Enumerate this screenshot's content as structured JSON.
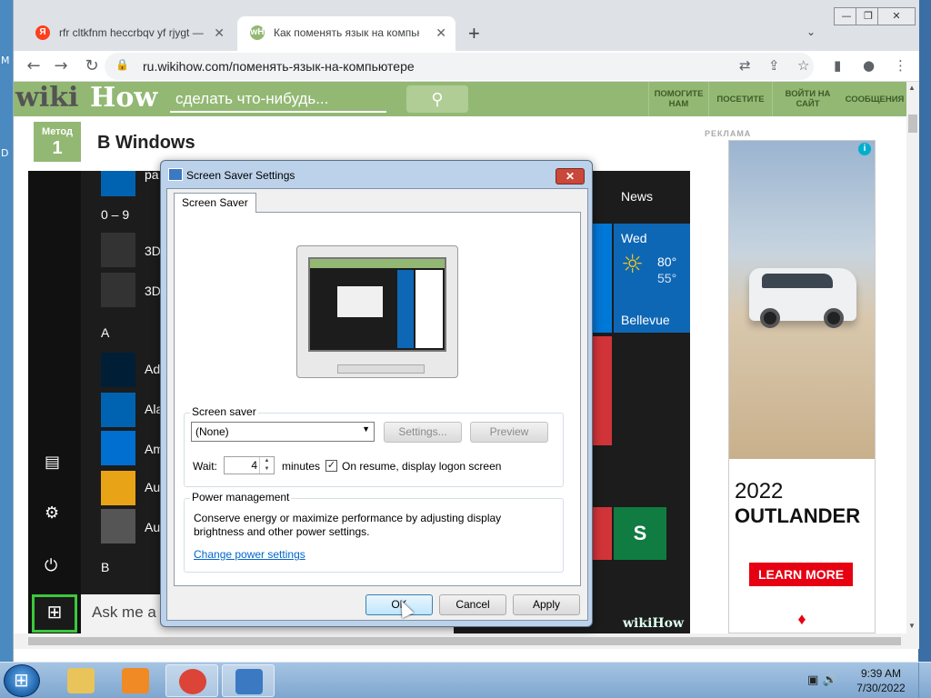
{
  "desktop": {
    "edge_letters": [
      "M",
      "D"
    ]
  },
  "browser": {
    "window_controls": [
      "—",
      "❐",
      "✕"
    ],
    "tabs": [
      {
        "title": "rfr cltkfnm heccrbqv yf rjygt — Я",
        "favicon": "yandex-icon",
        "favicon_letter": "Я",
        "favicon_color": "#fc3f1d",
        "active": false
      },
      {
        "title": "Как поменять язык на компьют",
        "favicon": "wikihow-icon",
        "favicon_letter": "wH",
        "favicon_color": "#93b874",
        "active": true
      }
    ],
    "new_tab": "+",
    "url": "ru.wikihow.com/поменять-язык-на-компьютере"
  },
  "wikihow": {
    "logo_wiki": "wiki",
    "logo_how": "How",
    "search_placeholder": "сделать что-нибудь...",
    "nav": [
      {
        "label": "ПОМОГИТЕ НАМ"
      },
      {
        "label": "ПОСЕТИТЕ"
      },
      {
        "label": "ВОЙТИ НА САЙТ"
      },
      {
        "label": "СООБЩЕНИЯ"
      }
    ],
    "method_label": "Метод",
    "method_number": "1",
    "method_title": "В Windows",
    "ad_label": "РЕКЛАМА",
    "ad": {
      "year": "2022",
      "model": "OUTLANDER",
      "cta": "LEARN MORE",
      "info": "i"
    },
    "watermark": "wikiHow"
  },
  "startmenu": {
    "apps": [
      {
        "label": "pa",
        "color": "#0063b1"
      },
      {
        "label": "3D",
        "color": "#333333"
      },
      {
        "label": "3D",
        "color": "#333333"
      },
      {
        "label": "Ad",
        "color": "#001e36"
      },
      {
        "label": "Ala",
        "color": "#0063b1"
      },
      {
        "label": "Am",
        "color": "#016fd0"
      },
      {
        "label": "Au",
        "color": "#e8a317"
      },
      {
        "label": "Au",
        "color": "#555555"
      }
    ],
    "headers": [
      "0 – 9",
      "A",
      "B"
    ],
    "search_text": "Ask me a",
    "news": "News",
    "weather": {
      "day": "Wed",
      "high": "80°",
      "low": "55°",
      "city": "Bellevue"
    }
  },
  "dialog": {
    "title": "Screen Saver Settings",
    "tab": "Screen Saver",
    "screensaver_group": "Screen saver",
    "selected": "(None)",
    "settings_btn": "Settings...",
    "preview_btn": "Preview",
    "wait_label": "Wait:",
    "wait_value": "4",
    "minutes_label": "minutes",
    "resume_label": "On resume, display logon screen",
    "resume_checked": "✓",
    "power_group": "Power management",
    "power_text": "Conserve energy or maximize performance by adjusting display brightness and other power settings.",
    "power_link": "Change power settings",
    "ok": "OK",
    "cancel": "Cancel",
    "apply": "Apply"
  },
  "taskbar": {
    "time": "9:39 AM",
    "date": "7/30/2022",
    "apps": [
      {
        "name": "explorer",
        "color": "#e8c45a"
      },
      {
        "name": "media-player",
        "color": "#f08a24"
      },
      {
        "name": "chrome",
        "color": "#db4437"
      },
      {
        "name": "screen-saver",
        "color": "#3b7ac2"
      }
    ]
  }
}
